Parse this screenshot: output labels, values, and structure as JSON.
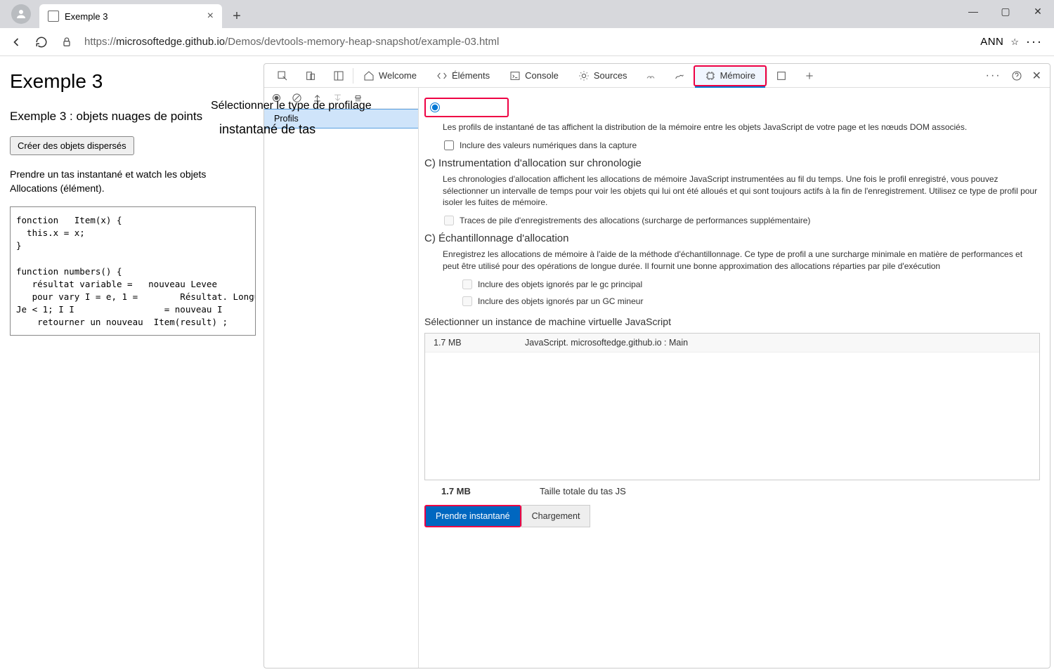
{
  "window": {
    "tab_title": "Exemple 3",
    "url_protocol": "https://",
    "url_host": "microsoftedge.github.io",
    "url_path": "/Demos/devtools-memory-heap-snapshot/example-03.html",
    "profile_badge": "ANN"
  },
  "page": {
    "h1": "Exemple 3",
    "h2": "Exemple 3 : objets nuages de points",
    "button": "Créer des objets dispersés",
    "para": "Prendre un tas instantané et watch les objets Allocations (élément).",
    "code": "fonction   Item(x) {\n  this.x = x;\n}\n\nfunction numbers() {\n   résultat variable =   nouveau Levee\n   pour vary I = e, 1 =        Résultat. Longueur;\nJe < 1; I I                 = nouveau I\n    retourner un nouveau  Item(result) ;"
  },
  "overlay": {
    "line1": "Sélectionner le type de profilage",
    "line2": "instantané de tas"
  },
  "devtools": {
    "tabs": {
      "welcome": "Welcome",
      "elements": "Éléments",
      "console": "Console",
      "sources": "Sources",
      "memory": "Mémoire"
    },
    "sidebar": {
      "profiles_label": "Profils"
    },
    "memory": {
      "heap_desc": "Les profils de instantané de tas affichent la distribution de la mémoire entre les objets JavaScript de votre page et les nœuds DOM associés.",
      "heap_check": "Inclure des valeurs numériques dans la capture",
      "timeline_hd": "C) Instrumentation d'allocation sur chronologie",
      "timeline_desc": "Les chronologies d'allocation affichent les allocations de mémoire JavaScript instrumentées au fil du temps. Une fois le profil enregistré, vous pouvez sélectionner un intervalle de temps pour voir les objets qui lui ont été alloués et qui sont toujours actifs à la fin de l'enregistrement. Utilisez ce type de profil pour isoler les fuites de mémoire.",
      "timeline_check": "Traces de pile d'enregistrements des allocations (surcharge de performances supplémentaire)",
      "sampling_hd": "C) Échantillonnage d'allocation",
      "sampling_desc": "Enregistrez les allocations de mémoire à l'aide de la méthode d'échantillonnage. Ce type de profil a une surcharge minimale en matière de performances et peut être utilisé pour des opérations de longue durée. Il fournit une bonne approximation des allocations réparties par pile d'exécution",
      "sampling_check1": "Inclure des objets ignorés par le gc principal",
      "sampling_check2": "Inclure des objets ignorés par un GC mineur",
      "vm_hd": "Sélectionner un instance de machine virtuelle JavaScript",
      "vm_row_size": "1.7 MB",
      "vm_row_name": "JavaScript. microsoftedge.github.io : Main",
      "total_size": "1.7 MB",
      "total_label": "Taille totale du tas JS",
      "btn_snapshot": "Prendre instantané",
      "btn_load": "Chargement"
    }
  }
}
